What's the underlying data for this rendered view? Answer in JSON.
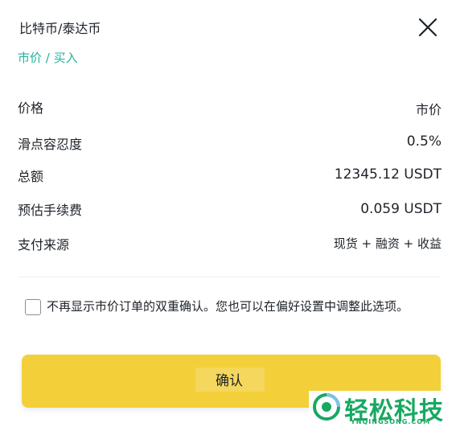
{
  "header": {
    "title": "比特币/泰达币",
    "subtitle": "市价 / 买入",
    "close_icon": "close-icon"
  },
  "details": {
    "rows": [
      {
        "label": "价格",
        "value": "市价"
      },
      {
        "label": "滑点容忍度",
        "value": "0.5%"
      },
      {
        "label": "总额",
        "value": "12345.12 USDT"
      },
      {
        "label": "预估手续费",
        "value": "0.059 USDT"
      },
      {
        "label": "支付来源",
        "value": "现货 + 融资 + 收益"
      }
    ]
  },
  "confirm_option": {
    "checked": false,
    "label": "不再显示市价订单的双重确认。您也可以在偏好设置中调整此选项。"
  },
  "confirm_button": {
    "label": "确认"
  },
  "watermark": {
    "text": "轻松科技",
    "sub": "YNQINGSONG.COM"
  },
  "colors": {
    "accent_green": "#22b39a",
    "button_yellow": "#f3cf3a",
    "watermark_green": "#19a862",
    "text": "#1e2329"
  }
}
